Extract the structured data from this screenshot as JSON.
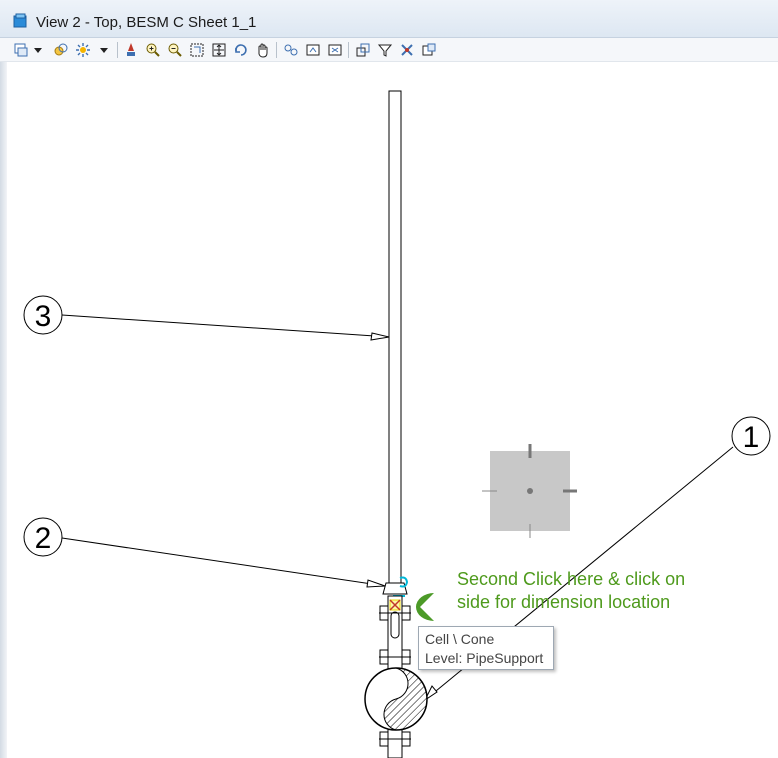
{
  "window": {
    "title": "View 2 - Top, BESM C Sheet 1_1"
  },
  "toolbar": {
    "icons": [
      "view-attributes-icon",
      "dropdown-icon",
      "levels-icon",
      "display-style-icon",
      "dropdown-icon",
      "update-view-icon",
      "zoom-in-icon",
      "zoom-out-icon",
      "window-area-icon",
      "fit-view-icon",
      "rotate-view-icon",
      "pan-view-icon",
      "view-previous-icon",
      "view-next-icon",
      "copy-view-icon",
      "clip-volume-icon",
      "clip-mask-icon",
      "view-filter-icon",
      "section-icon"
    ]
  },
  "callouts": [
    "1",
    "2",
    "3"
  ],
  "instruction": {
    "step": "2",
    "line1": "Second Click here & click on",
    "line2": "side for dimension location"
  },
  "tooltip": {
    "line1": "Cell \\ Cone",
    "line2": "Level: PipeSupport"
  },
  "colors": {
    "instruction_green": "#4e9a1c",
    "badge_green": "#4c9a28",
    "drawing_black": "#000000",
    "highlight_yellow": "#e8d800",
    "highlight_cyan": "#00b7d7",
    "cursor_gray": "#c8c8c8"
  }
}
